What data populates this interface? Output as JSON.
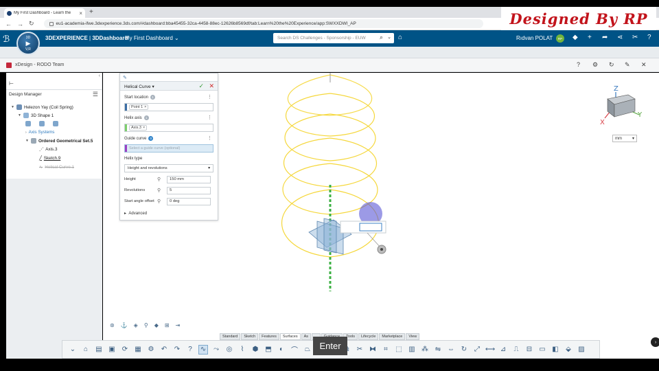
{
  "browser": {
    "tab_title": "My First Dashboard - Learn the",
    "url": "eu1-academia-ifwe.3dexperience.3ds.com/#dashboard:bba45455-32ca-4458-88ec-12626b8569df/tab:Learn%20the%20Experience/app:SWXXDWI_AP"
  },
  "watermark": "Designed By RP",
  "topbar": {
    "brand_bold": "3DEXPERIENCE",
    "brand_sep": " | ",
    "brand_app": "3DDashboard",
    "dashboard": "My First Dashboard",
    "search_placeholder": "Search DS Challenges - Sponsorship - EUW",
    "user": "Rıdvan POLAT",
    "user_badge": "RP",
    "compass_top": "3D",
    "compass_bottom": "V,R"
  },
  "app": {
    "title": "xDesign - RODO Team"
  },
  "design_manager": {
    "title": "Design Manager",
    "tree": [
      {
        "label": "Helezon Yay (Coil Spring)"
      },
      {
        "label": "3D Shape 1"
      },
      {
        "label": "Axis Systems"
      },
      {
        "label": "Ordered Geometrical Set.5"
      },
      {
        "label": "Axis.3"
      },
      {
        "label": "Sketch.9"
      },
      {
        "label": "Helical Curve.1"
      }
    ]
  },
  "helical_panel": {
    "title": "Helical Curve",
    "start_location_label": "Start location",
    "start_location_count": "1",
    "start_location_value": "Point 1",
    "helix_axis_label": "Helix axis",
    "helix_axis_count": "1",
    "helix_axis_value": "Axis.3",
    "guide_curve_label": "Guide curve",
    "guide_curve_count": "0",
    "guide_curve_placeholder": "Select a guide curve (optional)",
    "helix_type_label": "Helix type",
    "helix_type_value": "Height and revolutions",
    "height_label": "Height",
    "height_value": "150 mm",
    "revolutions_label": "Revolutions",
    "revolutions_value": "5",
    "start_angle_label": "Start angle offset",
    "start_angle_value": "0 deg",
    "advanced_label": "Advanced"
  },
  "viewport": {
    "units": "mm",
    "axis_x": "X",
    "axis_y": "Y",
    "axis_z": "Z"
  },
  "bottom_tabs": [
    "Standard",
    "Sketch",
    "Features",
    "Surfaces",
    "As",
    "...",
    "Guidance",
    "Tools",
    "Lifecycle",
    "Marketplace",
    "View"
  ],
  "active_tab": "Surfaces",
  "enter_key": "Enter",
  "colors": {
    "topbar": "#005386",
    "helix": "#f5d73a",
    "axis": "#3cb043",
    "watermark": "#c2131b"
  }
}
